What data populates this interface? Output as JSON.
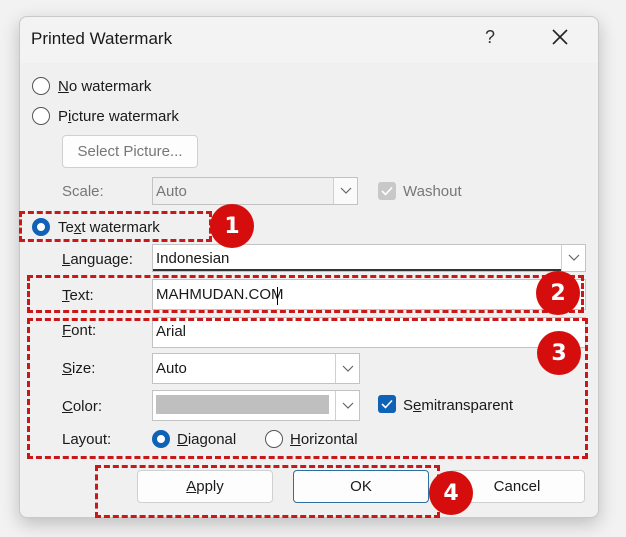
{
  "dialog": {
    "title": "Printed Watermark",
    "help_label": "?",
    "close_icon": "close-icon"
  },
  "options": {
    "no_watermark": {
      "prefix": "",
      "key": "N",
      "rest": "o watermark",
      "checked": false
    },
    "picture_watermark": {
      "prefix": "P",
      "key": "i",
      "rest": "cture watermark",
      "checked": false
    },
    "text_watermark": {
      "prefix": "Te",
      "key": "x",
      "rest": "t watermark",
      "checked": true
    }
  },
  "picture": {
    "select_button": "Select Picture...",
    "scale_label": "Scale:",
    "scale_value": "Auto",
    "washout_label": "Washout",
    "washout_checked": true
  },
  "text": {
    "language_label": {
      "key": "L",
      "rest": "anguage:"
    },
    "language_value": "Indonesian",
    "text_label": {
      "key": "T",
      "rest": "ext:"
    },
    "text_value": "MAHMUDAN.COM",
    "font_label": {
      "key": "F",
      "rest": "ont:"
    },
    "font_value": "Arial",
    "size_label": {
      "key": "S",
      "rest": "ize:"
    },
    "size_value": "Auto",
    "color_label": {
      "key": "C",
      "rest": "olor:"
    },
    "color_value": "#bfbfbf",
    "semitransparent_label": {
      "prefix": "S",
      "key": "e",
      "rest": "mitransparent"
    },
    "semitransparent_checked": true,
    "layout_label": "Layout:",
    "layout_diagonal": {
      "key": "D",
      "rest": "iagonal",
      "checked": true
    },
    "layout_horizontal": {
      "key": "H",
      "rest": "orizontal",
      "checked": false
    }
  },
  "buttons": {
    "apply": {
      "key": "A",
      "rest": "pply"
    },
    "ok": "OK",
    "cancel": "Cancel"
  },
  "annotations": {
    "badge_1": "1",
    "badge_2": "2",
    "badge_3": "3",
    "badge_4": "4",
    "highlight_color": "#c91818",
    "badge_color": "#d60d0d"
  },
  "accent_color": "#0f62b6"
}
